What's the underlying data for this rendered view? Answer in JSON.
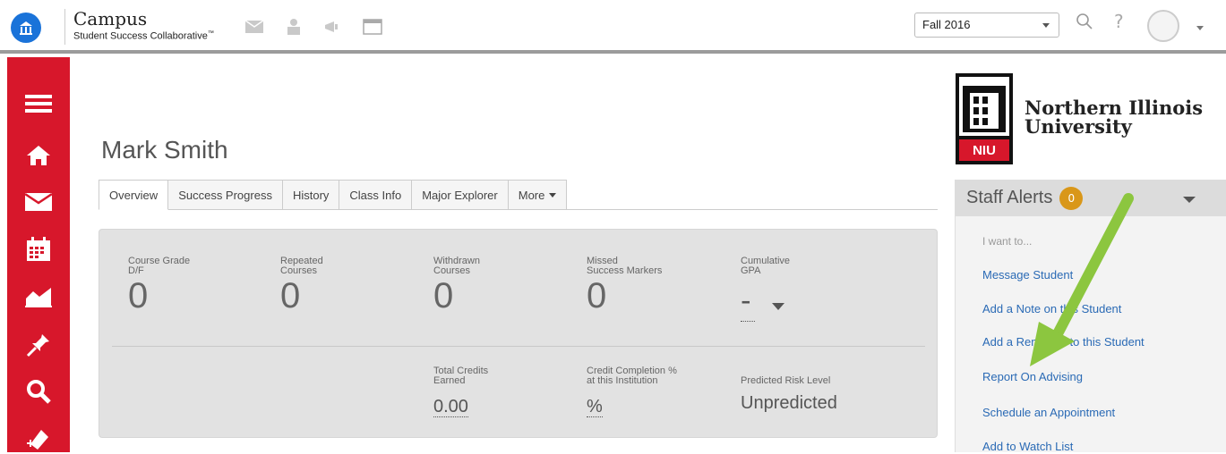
{
  "brand": {
    "title": "Campus",
    "subtitle": "Student Success Collaborative",
    "subtitle_mark": "™"
  },
  "header": {
    "term": "Fall 2016",
    "help": "?"
  },
  "sidebar": {
    "items": [
      {
        "icon": "menu-icon"
      },
      {
        "icon": "home-icon"
      },
      {
        "icon": "envelope-icon"
      },
      {
        "icon": "calendar-icon"
      },
      {
        "icon": "chart-icon"
      },
      {
        "icon": "pin-icon"
      },
      {
        "icon": "search-icon"
      },
      {
        "icon": "add-user-icon"
      }
    ]
  },
  "student": {
    "name": "Mark Smith"
  },
  "tabs": [
    {
      "label": "Overview",
      "active": true
    },
    {
      "label": "Success Progress"
    },
    {
      "label": "History"
    },
    {
      "label": "Class Info"
    },
    {
      "label": "Major Explorer"
    },
    {
      "label": "More"
    }
  ],
  "stats": {
    "course_grade": {
      "label": "Course Grade\nD/F",
      "value": "0"
    },
    "repeated": {
      "label": "Repeated\nCourses",
      "value": "0"
    },
    "withdrawn": {
      "label": "Withdrawn\nCourses",
      "value": "0"
    },
    "missed": {
      "label": "Missed\nSuccess Markers",
      "value": "0"
    },
    "gpa": {
      "label": "Cumulative\nGPA",
      "value": "-"
    },
    "total_credits": {
      "label": "Total Credits\nEarned",
      "value": "0.00"
    },
    "credit_completion": {
      "label": "Credit Completion %\nat this Institution",
      "value": "%"
    },
    "risk": {
      "label": "Predicted Risk Level",
      "value": "Unpredicted"
    }
  },
  "institution": {
    "name": "Northern Illinois\nUniversity",
    "abbr": "NIU"
  },
  "alerts": {
    "title": "Staff Alerts",
    "count": "0",
    "want": "I want to...",
    "actions": [
      "Message Student",
      "Add a Note on this Student",
      "Add a Reminder to this Student",
      "Report On Advising",
      "Schedule an Appointment",
      "Add to Watch List"
    ]
  },
  "colors": {
    "sidebar": "#d7172b",
    "link": "#2a6ab5",
    "badge": "#d99719",
    "arrow": "#8cc63f"
  }
}
